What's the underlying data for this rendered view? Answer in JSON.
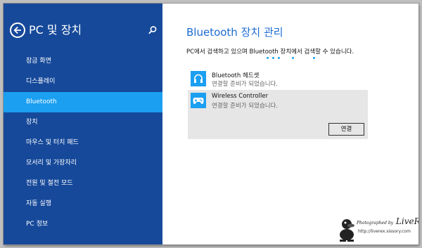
{
  "sidebar": {
    "title": "PC 및 장치",
    "items": [
      {
        "label": "잠금 화면",
        "active": false
      },
      {
        "label": "디스플레이",
        "active": false
      },
      {
        "label": "Bluetooth",
        "active": true
      },
      {
        "label": "장치",
        "active": false
      },
      {
        "label": "마우스 및 터치 패드",
        "active": false
      },
      {
        "label": "모서리 및 가장자리",
        "active": false
      },
      {
        "label": "전원 및 절전 모드",
        "active": false
      },
      {
        "label": "자동 실행",
        "active": false
      },
      {
        "label": "PC 정보",
        "active": false
      }
    ]
  },
  "main": {
    "title": "Bluetooth 장치 관리",
    "scan_text": "PC에서 검색하고 있으며 Bluetooth 장치에서 검색할 수 있습니다.",
    "devices": [
      {
        "name": "Bluetooth 헤드셋",
        "status": "연결할 준비가 되었습니다.",
        "icon": "headset-icon",
        "selected": false
      },
      {
        "name": "Wireless Controller",
        "status": "연결할 준비가 되었습니다.",
        "icon": "gamepad-icon",
        "selected": true
      }
    ],
    "connect_label": "연결"
  },
  "watermark": {
    "signature": "LiveREX",
    "by": "Photographed by",
    "url": "http://liverex.sissory.com"
  },
  "colors": {
    "sidebar_bg": "#16499a",
    "accent": "#1b9ff1",
    "title_blue": "#1b6bd1"
  }
}
